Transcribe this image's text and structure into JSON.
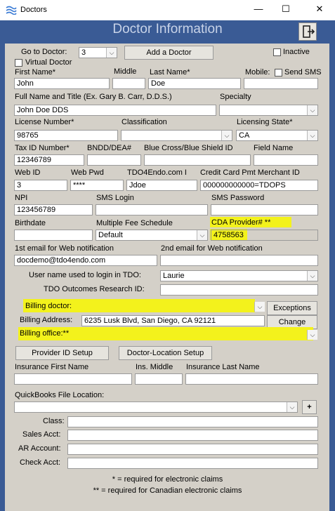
{
  "window": {
    "title": "Doctors",
    "minimize": "—",
    "maximize": "☐",
    "close": "✕"
  },
  "header": {
    "title": "Doctor Information",
    "exit_icon": "exit-door-icon"
  },
  "top": {
    "goto_label": "Go to Doctor:",
    "goto_value": "3",
    "add_doctor": "Add a Doctor",
    "inactive_label": "Inactive",
    "virtual_label": "Virtual Doctor"
  },
  "name": {
    "first_label": "First Name*",
    "first_value": "John",
    "middle_label": "Middle",
    "middle_value": "",
    "last_label": "Last Name*",
    "last_value": "Doe",
    "mobile_label": "Mobile:",
    "send_sms_label": "Send SMS",
    "mobile_value": ""
  },
  "fullname": {
    "label": "Full Name and Title (Ex. Gary B. Carr, D.D.S.)",
    "value": "John Doe DDS",
    "specialty_label": "Specialty",
    "specialty_value": ""
  },
  "license": {
    "number_label": "License Number*",
    "number_value": "98765",
    "classification_label": "Classification",
    "classification_value": "",
    "state_label": "Licensing State*",
    "state_value": "CA"
  },
  "ids": {
    "tax_label": "Tax ID Number*",
    "tax_value": "12346789",
    "bndd_label": "BNDD/DEA#",
    "bndd_value": "",
    "bcbs_label": "Blue Cross/Blue Shield ID",
    "bcbs_value": "",
    "field_label": "Field Name",
    "field_value": ""
  },
  "web": {
    "webid_label": "Web ID",
    "webid_value": "3",
    "webpwd_label": "Web Pwd",
    "webpwd_value": "****",
    "tdo_label": "TDO4Endo.com I",
    "tdo_value": "Jdoe",
    "cc_label": "Credit Card Pmt Merchant ID",
    "cc_value": "000000000000=TDOPS"
  },
  "npi": {
    "npi_label": "NPI",
    "npi_value": "123456789",
    "sms_login_label": "SMS Login",
    "sms_login_value": "",
    "sms_pwd_label": "SMS Password",
    "sms_pwd_value": ""
  },
  "birth": {
    "birthdate_label": "Birthdate",
    "birthdate_value": "",
    "fee_label": "Multiple Fee Schedule",
    "fee_value": "Default",
    "cda_label": "CDA Provider# **",
    "cda_value": "4758563"
  },
  "email": {
    "first_label": "1st email for Web notification",
    "first_value": "docdemo@tdo4endo.com",
    "second_label": "2nd email for Web notification",
    "second_value": ""
  },
  "login": {
    "user_label": "User name used to login in TDO:",
    "user_value": "Laurie",
    "outcomes_label": "TDO Outcomes Research ID:",
    "outcomes_value": ""
  },
  "billing": {
    "doctor_label": "Billing doctor:",
    "doctor_value": "",
    "exceptions": "Exceptions",
    "address_label": "Billing Address:",
    "address_value": "6235 Lusk Blvd, San Diego, CA 92121",
    "change": "Change",
    "office_label": "Billing office:**",
    "office_value": ""
  },
  "setup": {
    "provider_id": "Provider ID Setup",
    "doctor_location": "Doctor-Location Setup"
  },
  "insurance": {
    "first_label": "Insurance First Name",
    "first_value": "",
    "middle_label": "Ins. Middle",
    "middle_value": "",
    "last_label": "Insurance Last Name",
    "last_value": ""
  },
  "quickbooks": {
    "label": "QuickBooks File Location:",
    "value": "",
    "add": "+",
    "class_label": "Class:",
    "sales_label": "Sales Acct:",
    "ar_label": "AR Account:",
    "check_label": "Check Acct:"
  },
  "footer": {
    "note1": "* = required for electronic claims",
    "note2": "** = required for Canadian electronic claims"
  },
  "colors": {
    "frame": "#3a5b95",
    "panel": "#d4d0c8",
    "highlight": "#f3f21c"
  }
}
